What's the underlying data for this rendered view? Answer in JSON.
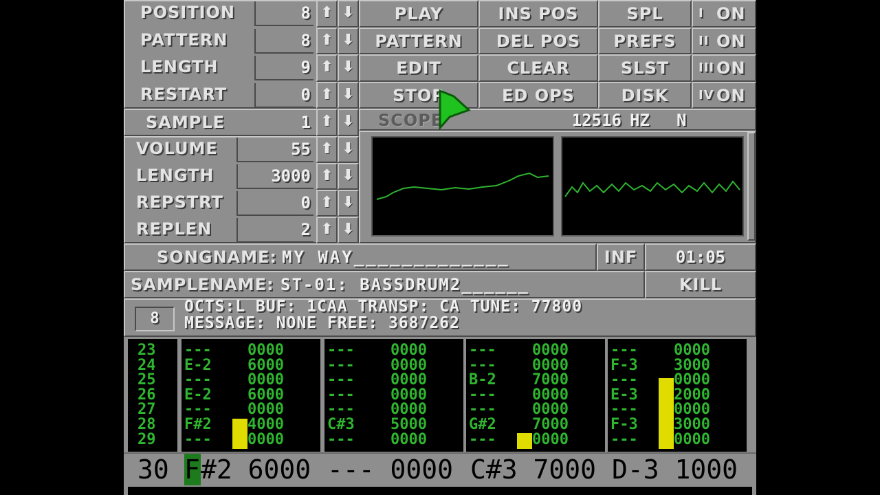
{
  "left_controls": [
    {
      "label": "POSITION",
      "value": "8"
    },
    {
      "label": "PATTERN",
      "value": "8"
    },
    {
      "label": "LENGTH",
      "value": "9"
    },
    {
      "label": "RESTART",
      "value": "0"
    }
  ],
  "arrow_up": "⬆",
  "arrow_down": "⬇",
  "buttons": [
    "PLAY",
    "INS POS",
    "SPL",
    "PATTERN",
    "DEL POS",
    "PREFS",
    "EDIT",
    "CLEAR",
    "SLST",
    "STOP",
    "ED OPS",
    "DISK"
  ],
  "channels": [
    {
      "roman": "I",
      "state": "ON"
    },
    {
      "roman": "II",
      "state": "ON"
    },
    {
      "roman": "III",
      "state": "ON"
    },
    {
      "roman": "IV",
      "state": "ON"
    }
  ],
  "sample": {
    "label": "SAMPLE",
    "value": "1"
  },
  "scope": {
    "label": "SCOPE",
    "freq": "12516",
    "unit": "HZ",
    "mode": "N"
  },
  "sample_params": [
    {
      "label": "VOLUME",
      "value": "55"
    },
    {
      "label": "LENGTH",
      "value": "3000"
    },
    {
      "label": "REPSTRT",
      "value": "0"
    },
    {
      "label": "REPLEN",
      "value": "2"
    }
  ],
  "songname": {
    "label": "SONGNAME:",
    "value": "MY WAY_____________"
  },
  "inf_label": "INF",
  "time": "01:05",
  "samplename": {
    "label": "SAMPLENAME:",
    "value": "ST-01: BASSDRUM2______"
  },
  "kill_label": "KILL",
  "status": {
    "box_value": "8",
    "line1": "OCTS:L  BUF: 1CAA TRANSP: CA TUNE:     77800",
    "line2": "MESSAGE: NONE                FREE: 3687262"
  },
  "row_numbers": [
    "23",
    "24",
    "25",
    "26",
    "27",
    "28",
    "29"
  ],
  "tracks": [
    [
      [
        "---",
        "0000"
      ],
      [
        "E-2",
        "6000"
      ],
      [
        "---",
        "0000"
      ],
      [
        "E-2",
        "6000"
      ],
      [
        "---",
        "0000"
      ],
      [
        "F#2",
        "4000"
      ],
      [
        "---",
        "0000"
      ]
    ],
    [
      [
        "---",
        "0000"
      ],
      [
        "---",
        "0000"
      ],
      [
        "---",
        "0000"
      ],
      [
        "---",
        "0000"
      ],
      [
        "---",
        "0000"
      ],
      [
        "C#3",
        "5000"
      ],
      [
        "---",
        "0000"
      ]
    ],
    [
      [
        "---",
        "0000"
      ],
      [
        "---",
        "0000"
      ],
      [
        "B-2",
        "7000"
      ],
      [
        "---",
        "0000"
      ],
      [
        "---",
        "0000"
      ],
      [
        "G#2",
        "7000"
      ],
      [
        "---",
        "0000"
      ]
    ],
    [
      [
        "---",
        "0000"
      ],
      [
        "F-3",
        "3000"
      ],
      [
        "---",
        "0000"
      ],
      [
        "E-3",
        "2000"
      ],
      [
        "---",
        "0000"
      ],
      [
        "F-3",
        "3000"
      ],
      [
        "---",
        "0000"
      ]
    ]
  ],
  "vu_levels": [
    0.27,
    0.0,
    0.14,
    0.63
  ],
  "vu_color": "#e0dc00",
  "current_row": {
    "num": "30",
    "cursor": "F",
    "ch1": "#2 6000",
    "ch2": "--- 0000",
    "ch3": "C#3 7000",
    "ch4": "D-3 1000"
  },
  "colors": {
    "panel": "#8e8e8e",
    "text_green": "#2fb52f",
    "cursor_green": "#1d7a1d",
    "pointer_green": "#1fc21f"
  },
  "icons": {
    "pointer": "mouse-pointer-icon"
  }
}
